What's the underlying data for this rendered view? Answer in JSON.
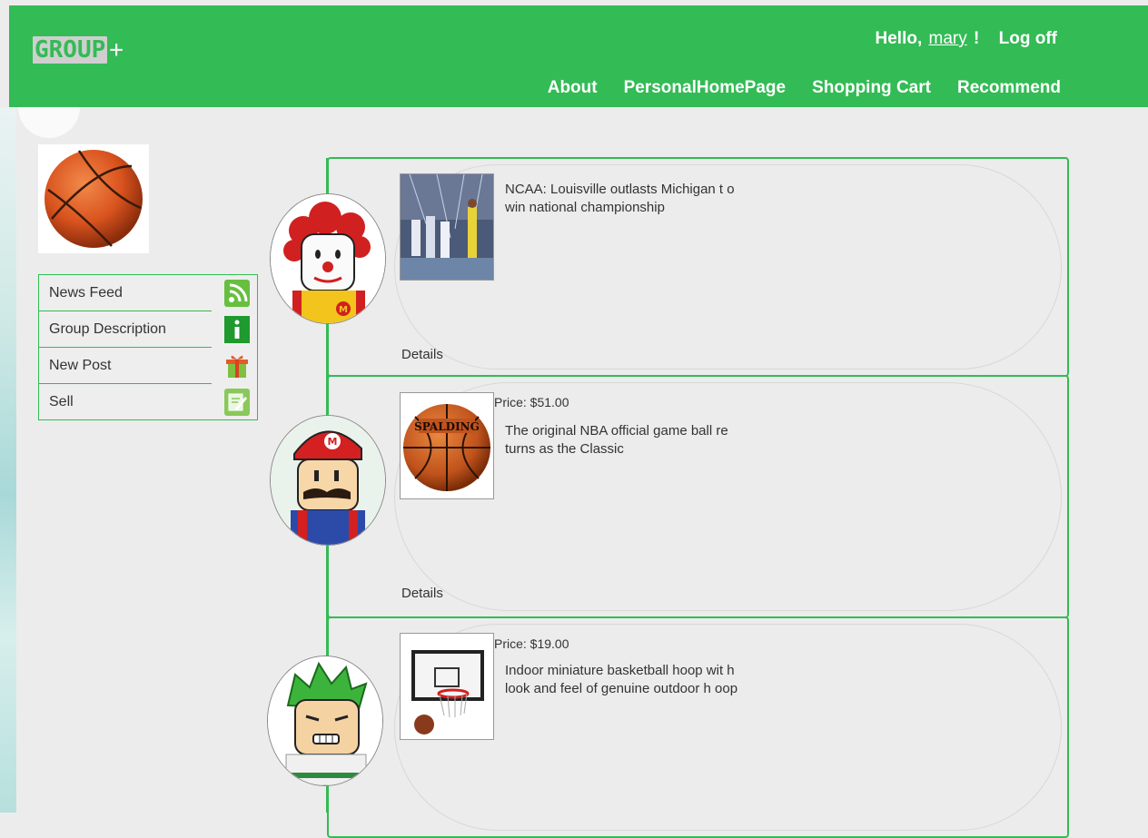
{
  "header": {
    "logo_main": "GROUP",
    "logo_plus": "+",
    "greeting_prefix": "Hello,",
    "username": "mary",
    "greeting_suffix": "!",
    "logoff": "Log off",
    "nav": [
      "About",
      "PersonalHomePage",
      "Shopping Cart",
      "Recommend"
    ]
  },
  "sidebar": {
    "group_image_icon": "basketball-icon",
    "menu": [
      {
        "label": "News Feed",
        "icon": "rss-icon"
      },
      {
        "label": "Group Description",
        "icon": "info-icon"
      },
      {
        "label": "New Post",
        "icon": "gift-icon"
      },
      {
        "label": "Sell",
        "icon": "edit-icon"
      }
    ]
  },
  "posts": [
    {
      "avatar": "clown-avatar",
      "thumb": "basketball-game-photo",
      "price": "",
      "text": "NCAA: Louisville outlasts Michigan t o win national championship",
      "details": "Details"
    },
    {
      "avatar": "mario-avatar",
      "thumb": "spalding-ball-photo",
      "price": "Price: $51.00",
      "text": "The original NBA official game ball re turns as the Classic",
      "details": "Details"
    },
    {
      "avatar": "green-hair-avatar",
      "thumb": "mini-hoop-photo",
      "price": "Price: $19.00",
      "text": "Indoor miniature basketball hoop wit h look and feel of genuine outdoor h oop",
      "details": ""
    }
  ],
  "colors": {
    "header_bg": "#33bb55",
    "page_bg": "#ececec",
    "accent": "#33bb55"
  }
}
